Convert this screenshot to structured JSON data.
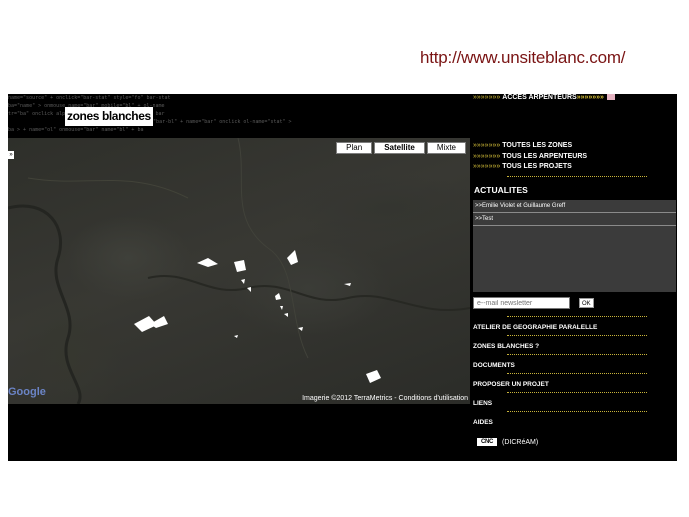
{
  "caption": {
    "url": "http://www.unsiteblanc.com/"
  },
  "header": {
    "logo_text": "zones blanches",
    "noise": [
      "name=\"source\"  +  onclick=\"bar-stat\"      style=\"fo\"     bar-stat",
      "ba=\"name\"  >  onmouse  name=\"bar\"         mobile=\"bl\"  +  ol-name",
      "tr=\"ba\"  onclick  alpha=\"2\"  name=\"bar\"       name=\"fo\"  >  bar",
      "name=\"bar-bl\"    +  name=\"bar\"   onclick      ol-name=\"stat\"  >",
      "ba  >  +  name=\"ol\"  onmouse=\"bar\"            name=\"bl\"  +  ba"
    ]
  },
  "map": {
    "types": [
      {
        "label": "Plan",
        "active": false
      },
      {
        "label": "Satellite",
        "active": true
      },
      {
        "label": "Mixte",
        "active": false
      }
    ],
    "credit": "Imagerie ©2012 TerraMetrics - Conditions d'utilisation",
    "google_logo": "Google",
    "collapse_arrow": "»"
  },
  "sidebar": {
    "top_link": "ACCES ARPENTEURS",
    "dash": "»»»»»»»",
    "nav": [
      "TOUTES LES ZONES",
      "TOUS LES ARPENTEURS",
      "TOUS LES PROJETS"
    ],
    "actualites_title": "ACTUALITES",
    "news": [
      ">>Emilie Violet et Guillaume Greff",
      ">>Test"
    ],
    "newsletter_placeholder": "e--mail newsletter",
    "ok_label": "OK",
    "menu": [
      "ATELIER DE GEOGRAPHIE PARALELLE",
      "ZONES BLANCHES ?",
      "DOCUMENTS",
      "PROPOSER UN PROJET",
      "LIENS",
      "AIDES"
    ],
    "cnc_logo": "CNC",
    "cnc_text": "(DICRéAM)"
  },
  "colors": {
    "dash_accent": "#d8c23a",
    "caption": "#7a1414"
  }
}
